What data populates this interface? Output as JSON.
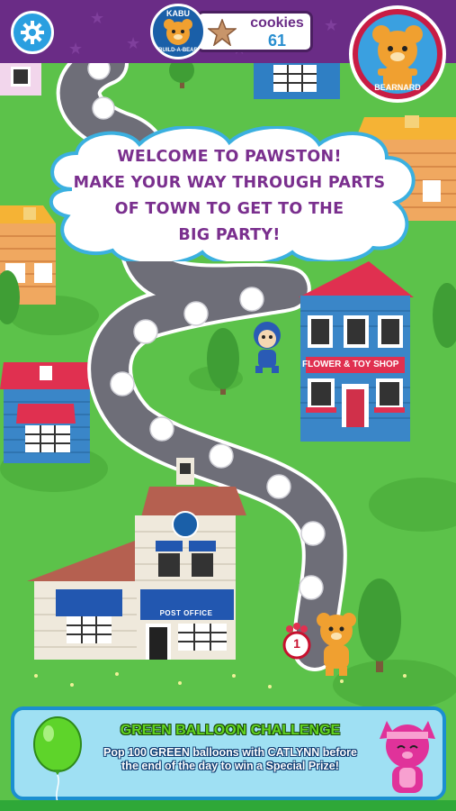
{
  "header": {
    "settings_icon": "gear-icon",
    "kabu_badge": {
      "top_text": "KABU",
      "bottom_text": "BUILD-A-BEAR"
    },
    "currency": {
      "label": "cookies",
      "value": "61",
      "icon": "star-cookie-icon"
    },
    "avatar": {
      "name": "BEARNARD"
    }
  },
  "welcome": {
    "lines": [
      "WELCOME TO PAWSTON!",
      "MAKE YOUR WAY THROUGH PARTS",
      "OF TOWN TO GET TO THE",
      "BIG PARTY!"
    ]
  },
  "map": {
    "shop_sign": "FLOWER & TOY SHOP",
    "post_office_sign": "POST OFFICE",
    "current_level": "1"
  },
  "challenge": {
    "title": "GREEN BALLOON CHALLENGE",
    "description": "Pop 100 GREEN balloons with CATLYNN before the end of the day to win a Special Prize!",
    "balloon_color": "#5ed42a",
    "accent_color": "#1b8fd0"
  },
  "colors": {
    "header_purple": "#6a2c86",
    "grass_green": "#5cc24a",
    "text_purple": "#7a2f8e"
  }
}
